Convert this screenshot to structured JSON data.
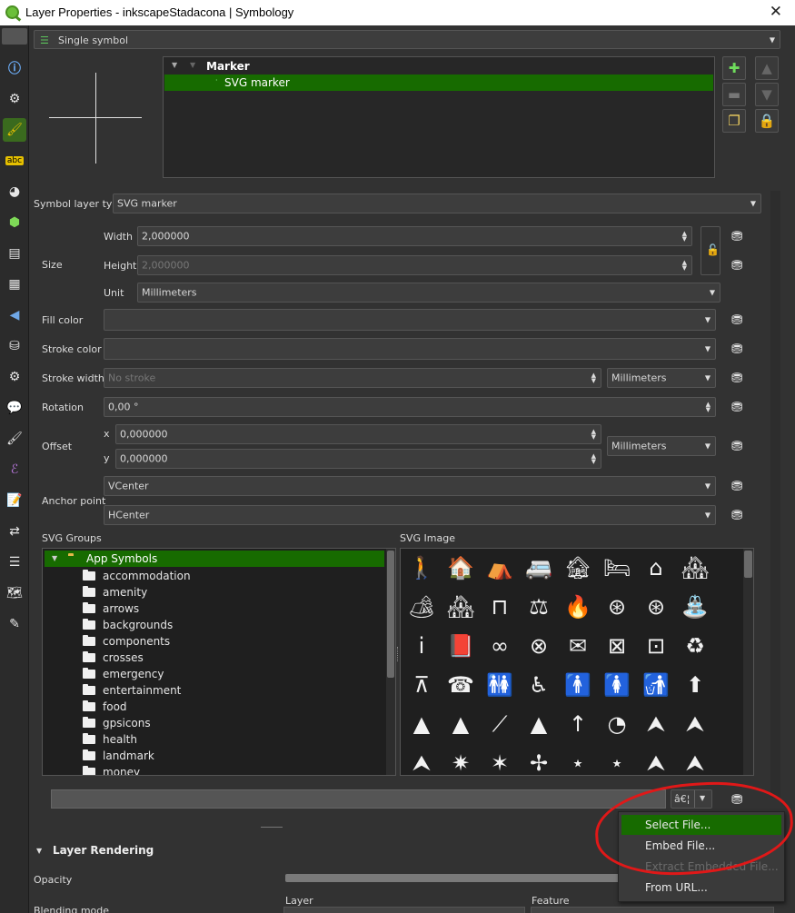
{
  "window": {
    "title": "Layer Properties - inkscapeStadacona | Symbology",
    "close_glyph": "✕"
  },
  "renderer": {
    "selected": "Single symbol"
  },
  "symbol_tree": {
    "root": "Marker",
    "selected_layer": "SVG marker"
  },
  "symbol_layer_type": {
    "label": "Symbol layer type",
    "value": "SVG marker"
  },
  "size": {
    "label": "Size",
    "width_label": "Width",
    "width_value": "2,000000",
    "height_label": "Height",
    "height_value": "2,000000",
    "unit_label": "Unit",
    "unit_value": "Millimeters"
  },
  "fill_color": {
    "label": "Fill color"
  },
  "stroke_color": {
    "label": "Stroke color"
  },
  "stroke_width": {
    "label": "Stroke width",
    "placeholder": "No stroke",
    "unit": "Millimeters"
  },
  "rotation": {
    "label": "Rotation",
    "value": "0,00 °"
  },
  "offset": {
    "label": "Offset",
    "x_label": "x",
    "x_value": "0,000000",
    "y_label": "y",
    "y_value": "0,000000",
    "unit": "Millimeters"
  },
  "anchor": {
    "label": "Anchor point",
    "vertical": "VCenter",
    "horizontal": "HCenter"
  },
  "svg_groups": {
    "label": "SVG Groups",
    "root": "App Symbols",
    "items": [
      "accommodation",
      "amenity",
      "arrows",
      "backgrounds",
      "components",
      "crosses",
      "emergency",
      "entertainment",
      "food",
      "gpsicons",
      "health",
      "landmark",
      "money"
    ]
  },
  "svg_image": {
    "label": "SVG Image",
    "symbols": [
      [
        "🚶",
        "🏠",
        "⛺",
        "🚐",
        "🏚",
        "🛏",
        "⌂",
        "🏘"
      ],
      [
        "🏕",
        "🏘",
        "⊓",
        "⚖",
        "🔥",
        "⊛",
        "⊛",
        "⛲"
      ],
      [
        "i",
        "📕",
        "∞",
        "⊗",
        "✉",
        "⊠",
        "⊡",
        "♻"
      ],
      [
        "⊼",
        "☎",
        "🚻",
        "♿",
        "🚹",
        "🚺",
        "🚮",
        "⬆"
      ],
      [
        "▲",
        "▲",
        "⟋",
        "▲",
        "↑",
        "◔",
        "⮝",
        "⮝"
      ],
      [
        "⮝",
        "✷",
        "✶",
        "✢",
        "⋆",
        "⋆",
        "⮝",
        "⮝"
      ]
    ]
  },
  "file_field": {
    "value": "",
    "ellipsis": "â€¦"
  },
  "file_menu": {
    "items": [
      {
        "label": "Select File...",
        "state": "highlighted"
      },
      {
        "label": "Embed File...",
        "state": "normal"
      },
      {
        "label": "Extract Embedded File...",
        "state": "disabled"
      },
      {
        "label": "From URL...",
        "state": "normal"
      }
    ]
  },
  "layer_rendering": {
    "title": "Layer Rendering",
    "opacity_label": "Opacity",
    "blending_label": "Blending mode",
    "layer_label": "Layer",
    "feature_label": "Feature"
  },
  "colors": {
    "accent_green": "#176b00",
    "annotation_red": "#e01818"
  }
}
